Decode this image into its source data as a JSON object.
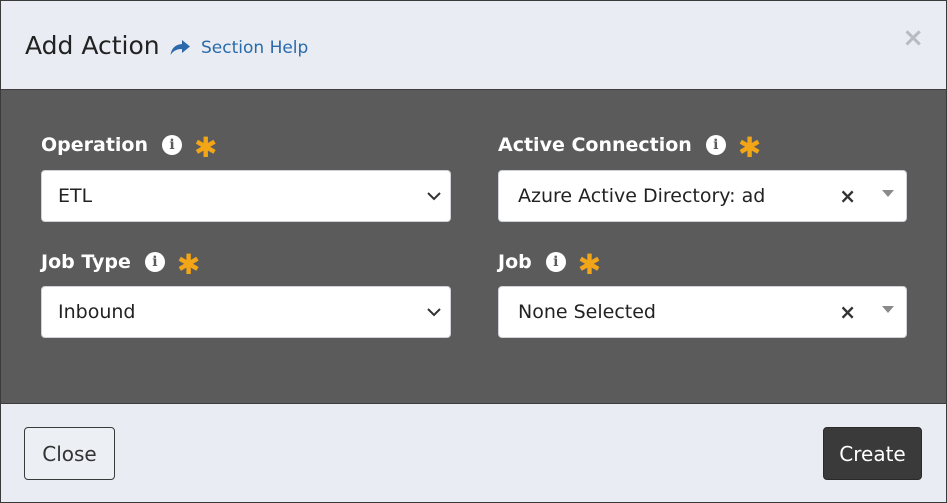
{
  "dialog": {
    "title": "Add Action",
    "help_link": "Section Help",
    "close_glyph": "×"
  },
  "fields": {
    "operation": {
      "label": "Operation",
      "value": "ETL",
      "required_glyph": "✱",
      "info_glyph": "i"
    },
    "active_connection": {
      "label": "Active Connection",
      "value": "Azure Active Directory: ad",
      "clear_glyph": "×",
      "required_glyph": "✱",
      "info_glyph": "i"
    },
    "job_type": {
      "label": "Job Type",
      "value": "Inbound",
      "required_glyph": "✱",
      "info_glyph": "i"
    },
    "job": {
      "label": "Job",
      "value": "None Selected",
      "clear_glyph": "×",
      "required_glyph": "✱",
      "info_glyph": "i"
    }
  },
  "footer": {
    "close_label": "Close",
    "create_label": "Create"
  },
  "icons": {
    "help": "share-arrow-icon",
    "info": "info-icon",
    "required": "asterisk-icon",
    "select": "chevron-down-icon",
    "combo": "caret-down-icon"
  },
  "colors": {
    "header_bg": "#e9edf3",
    "body_bg": "#5b5b5b",
    "link": "#2a6aaa",
    "required": "#f2a516",
    "primary_button": "#3a3a3a"
  }
}
